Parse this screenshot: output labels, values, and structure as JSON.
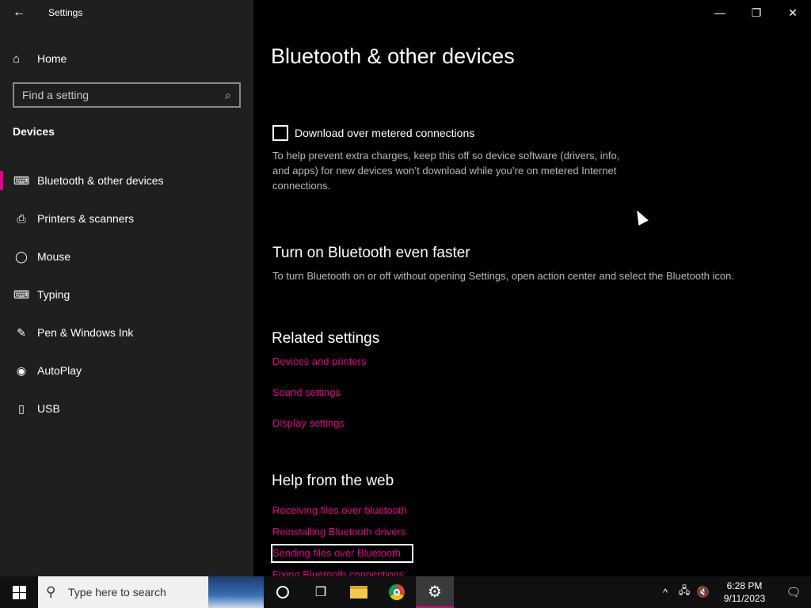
{
  "window": {
    "title": "Settings",
    "back_glyph": "←",
    "minimize_glyph": "—",
    "restore_glyph": "❐",
    "close_glyph": "✕"
  },
  "sidebar": {
    "home": {
      "icon": "home-icon",
      "glyph": "⌂",
      "label": "Home"
    },
    "search": {
      "placeholder": "Find a setting",
      "icon": "search-icon",
      "glyph": "⌕"
    },
    "section_heading": "Devices",
    "items": [
      {
        "label": "Bluetooth & other devices",
        "icon": "bluetooth-devices-icon",
        "glyph": "⌨",
        "active": true
      },
      {
        "label": "Printers & scanners",
        "icon": "printer-icon",
        "glyph": "⎙",
        "active": false
      },
      {
        "label": "Mouse",
        "icon": "mouse-icon",
        "glyph": "◯",
        "active": false
      },
      {
        "label": "Typing",
        "icon": "keyboard-icon",
        "glyph": "⌨",
        "active": false
      },
      {
        "label": "Pen & Windows Ink",
        "icon": "pen-icon",
        "glyph": "✎",
        "active": false
      },
      {
        "label": "AutoPlay",
        "icon": "autoplay-icon",
        "glyph": "◉",
        "active": false
      },
      {
        "label": "USB",
        "icon": "usb-icon",
        "glyph": "▯",
        "active": false
      }
    ]
  },
  "content": {
    "title": "Bluetooth & other devices",
    "metered": {
      "label": "Download over metered connections",
      "checked": false,
      "description": "To help prevent extra charges, keep this off so device software (drivers, info, and apps) for new devices won’t download while you’re on metered Internet connections."
    },
    "faster": {
      "heading": "Turn on Bluetooth even faster",
      "description": "To turn Bluetooth on or off without opening Settings, open action center and select the Bluetooth icon."
    },
    "related": {
      "heading": "Related settings",
      "links": [
        "Devices and printers",
        "Sound settings",
        "Display settings"
      ]
    },
    "help": {
      "heading": "Help from the web",
      "links": [
        "Receiving files over bluetooth",
        "Reinstalling Bluetooth drivers",
        "Sending files over Bluetooth",
        "Fixing Bluetooth connections"
      ]
    }
  },
  "taskbar": {
    "search_placeholder": "Type here to search",
    "search_glyph": "⚲",
    "taskview_glyph": "❒",
    "settings_glyph": "⚙",
    "tray": {
      "chevron": "^",
      "network": "🖧",
      "volume": "🔇"
    },
    "time": "6:28 PM",
    "date": "9/11/2023",
    "notification_glyph": "🗨"
  },
  "colors": {
    "accent": "#e3008c",
    "sidebar_bg": "#1f1f1f",
    "content_bg": "#000000"
  }
}
